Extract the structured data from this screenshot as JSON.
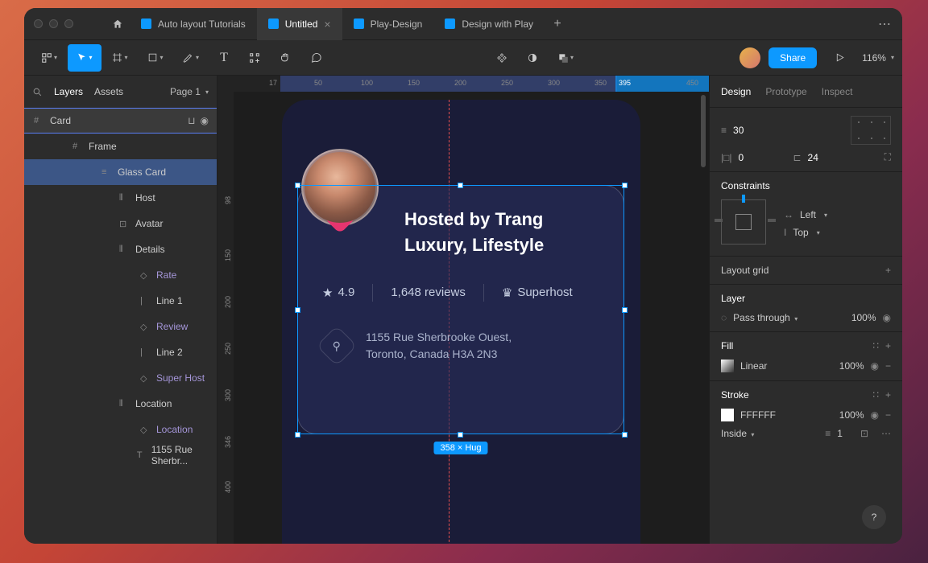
{
  "tabs": [
    {
      "label": "Auto layout Tutorials"
    },
    {
      "label": "Untitled",
      "active": true
    },
    {
      "label": "Play-Design"
    },
    {
      "label": "Design with Play"
    }
  ],
  "toolbar": {
    "share": "Share",
    "zoom": "116%"
  },
  "leftpanel": {
    "layers_tab": "Layers",
    "assets_tab": "Assets",
    "page": "Page 1",
    "card": "Card",
    "frame": "Frame",
    "glass": "Glass Card",
    "host": "Host",
    "avatar": "Avatar",
    "details": "Details",
    "rate": "Rate",
    "line1": "Line 1",
    "review": "Review",
    "line2": "Line 2",
    "superhost": "Super Host",
    "location": "Location",
    "location2": "Location",
    "addr": "1155 Rue Sherbr..."
  },
  "canvas": {
    "ruler_h": [
      "17",
      "50",
      "100",
      "150",
      "200",
      "250",
      "300",
      "350",
      "395",
      "450"
    ],
    "ruler_v": [
      "98",
      "150",
      "200",
      "250",
      "300",
      "346",
      "400"
    ],
    "title": "Hosted by Trang",
    "subtitle": "Luxury, Lifestyle",
    "rating": "4.9",
    "reviews": "1,648 reviews",
    "superhost": "Superhost",
    "addr1": "1155 Rue Sherbrooke Ouest,",
    "addr2": "Toronto, Canada H3A 2N3",
    "size": "358 × Hug"
  },
  "rightpanel": {
    "design": "Design",
    "prototype": "Prototype",
    "inspect": "Inspect",
    "v1": "30",
    "v2": "0",
    "v3": "24",
    "constraints": "Constraints",
    "c_h": "Left",
    "c_v": "Top",
    "layout_grid": "Layout grid",
    "layer": "Layer",
    "blend": "Pass through",
    "opacity": "100%",
    "fill": "Fill",
    "fill_type": "Linear",
    "fill_opacity": "100%",
    "stroke": "Stroke",
    "stroke_val": "FFFFFF",
    "stroke_opacity": "100%",
    "stroke_side": "Inside",
    "stroke_w": "1"
  }
}
